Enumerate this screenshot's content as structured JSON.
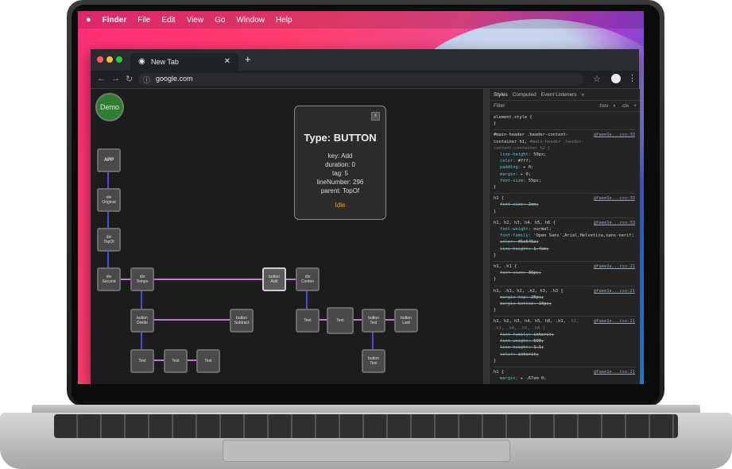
{
  "menubar": {
    "apple": "",
    "items": [
      "Finder",
      "File",
      "Edit",
      "View",
      "Go",
      "Window",
      "Help"
    ]
  },
  "browser": {
    "tab_title": "New Tab",
    "url": "google.com"
  },
  "app": {
    "demo_label": "Demo",
    "nodes": [
      {
        "id": "app",
        "lines": [
          "APP"
        ]
      },
      {
        "id": "div-original",
        "lines": [
          "div",
          "Original"
        ]
      },
      {
        "id": "div-topof",
        "lines": [
          "div",
          "TopOf"
        ]
      },
      {
        "id": "div-second",
        "lines": [
          "div",
          "Second"
        ]
      },
      {
        "id": "div-tempo",
        "lines": [
          "div",
          "Tempo"
        ]
      },
      {
        "id": "button-add",
        "lines": [
          "button",
          "Add"
        ]
      },
      {
        "id": "div-conten",
        "lines": [
          "div",
          "Conten"
        ]
      },
      {
        "id": "button-divide",
        "lines": [
          "button",
          "Divide"
        ]
      },
      {
        "id": "button-subtract",
        "lines": [
          "button",
          "Subtract"
        ]
      },
      {
        "id": "text-1",
        "lines": [
          "Text"
        ]
      },
      {
        "id": "text-2",
        "lines": [
          "Text"
        ]
      },
      {
        "id": "button-text-1",
        "lines": [
          "button",
          "Text"
        ]
      },
      {
        "id": "button-last",
        "lines": [
          "button",
          "Last"
        ]
      },
      {
        "id": "text-3",
        "lines": [
          "Text"
        ]
      },
      {
        "id": "text-4",
        "lines": [
          "Text"
        ]
      },
      {
        "id": "text-5",
        "lines": [
          "Text"
        ]
      },
      {
        "id": "button-text-2",
        "lines": [
          "button",
          "Text"
        ]
      }
    ],
    "tooltip": {
      "title": "Type: BUTTON",
      "close": "x",
      "lines": [
        "key: Add",
        "duration: 0",
        "tag: 5",
        "lineNumber: 296",
        "parent: TopOf"
      ],
      "status": "Idle"
    }
  },
  "devtools": {
    "tabs": [
      "Styles",
      "Computed",
      "Event Listeners",
      "»"
    ],
    "filter_placeholder": "Filter",
    "filter_actions": [
      ":hov",
      "◐",
      ".cls",
      "+"
    ],
    "rules": [
      {
        "selector": "element.style {",
        "props": [],
        "close": "}"
      },
      {
        "selector": "#main-header .header-content-container h1,",
        "dim": " #main-header .header-content-container h2 {",
        "source": "@faee1e...css:33",
        "props": [
          {
            "p": "line-height",
            "v": "50px;"
          },
          {
            "p": "color",
            "v": "#fff;"
          },
          {
            "p": "padding",
            "v": "▸ 0;"
          },
          {
            "p": "margin",
            "v": "▸ 0;"
          },
          {
            "p": "font-size",
            "v": "55px;"
          }
        ],
        "close": "}"
      },
      {
        "selector": "h1 {",
        "source": "@faee1e...css:33",
        "props": [
          {
            "p": "font-size",
            "v": "2em;",
            "s": true
          }
        ],
        "close": "}"
      },
      {
        "selector": "h1, h2, h3, h4, h5, h6 {",
        "source": "@faee1e...css:33",
        "props": [
          {
            "p": "font-weight",
            "v": "normal;"
          },
          {
            "p": "font-family",
            "v": "'Open Sans',Arial,Helvetica,sans-serif;"
          },
          {
            "p": "color",
            "v": "#5e646a;",
            "s": true
          },
          {
            "p": "line-height",
            "v": "1.4em;",
            "s": true
          }
        ],
        "close": "}"
      },
      {
        "selector": "h1, .h1 {",
        "source": "@faee1e...css:21",
        "props": [
          {
            "p": "font-size",
            "v": "36px;",
            "s": true
          }
        ],
        "close": "}"
      },
      {
        "selector": "h1, .h1, h2, .h2, h3, .h3 {",
        "source": "@faee1e...css:21",
        "props": [
          {
            "p": "margin-top",
            "v": "20px;",
            "s": true
          },
          {
            "p": "margin-bottom",
            "v": "10px;",
            "s": true
          }
        ],
        "close": "}"
      },
      {
        "selector": "h1, h2, h3, h4, h5, h6, .h1,",
        "dim": " .h2, .h3, .h4, .h5, .h6 {",
        "source": "@faee1e...css:21",
        "props": [
          {
            "p": "font-family",
            "v": "inherit;",
            "s": true
          },
          {
            "p": "font-weight",
            "v": "500;",
            "s": true
          },
          {
            "p": "line-height",
            "v": "1.1;",
            "s": true
          },
          {
            "p": "color",
            "v": "inherit;",
            "s": true
          }
        ],
        "close": "}"
      },
      {
        "selector": "h1 {",
        "source": "@faee1e...css:21",
        "props": [
          {
            "p": "margin",
            "v": "▸ .67em 0;"
          }
        ],
        "close": ""
      }
    ]
  },
  "colors": {
    "accent": "#2f7d32",
    "edge_blue": "#4b4bd6",
    "edge_pink": "#c873d6",
    "tooltip_status": "#f0a020"
  }
}
